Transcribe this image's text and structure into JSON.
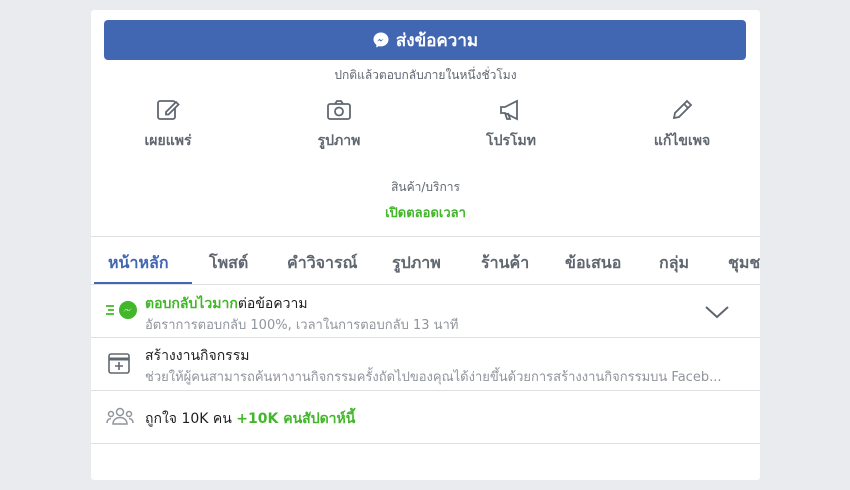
{
  "send_button": {
    "label": "ส่งข้อความ"
  },
  "reply_note": "ปกติแล้วตอบกลับภายในหนึ่งชั่วโมง",
  "actions": [
    {
      "label": "เผยแพร่",
      "icon": "edit-icon"
    },
    {
      "label": "รูปภาพ",
      "icon": "camera-icon"
    },
    {
      "label": "โปรโมท",
      "icon": "megaphone-icon"
    },
    {
      "label": "แก้ไขเพจ",
      "icon": "pencil-icon"
    }
  ],
  "category": "สินค้า/บริการ",
  "open_status": "เปิดตลอดเวลา",
  "tabs": [
    {
      "label": "หน้าหลัก",
      "active": true
    },
    {
      "label": "โพสต์"
    },
    {
      "label": "คำวิจารณ์"
    },
    {
      "label": "รูปภาพ"
    },
    {
      "label": "ร้านค้า"
    },
    {
      "label": "ข้อเสนอ"
    },
    {
      "label": "กลุ่ม"
    },
    {
      "label": "ชุมช"
    }
  ],
  "responsiveness": {
    "title_highlight": "ตอบกลับไวมาก",
    "title_rest": "ต่อข้อความ",
    "subtitle": "อัตราการตอบกลับ 100%, เวลาในการตอบกลับ 13 นาที"
  },
  "create_event": {
    "title": "สร้างงานกิจกรรม",
    "subtitle": "ช่วยให้ผู้คนสามารถค้นหางานกิจกรรมครั้งถัดไปของคุณได้ง่ายขึ้นด้วยการสร้างงานกิจกรรมบน Faceb..."
  },
  "likes": {
    "text": "ถูกใจ 10K คน",
    "delta": "+10K คนสัปดาห์นี้"
  },
  "colors": {
    "brand": "#4267b2",
    "accent_green": "#42b72a"
  }
}
